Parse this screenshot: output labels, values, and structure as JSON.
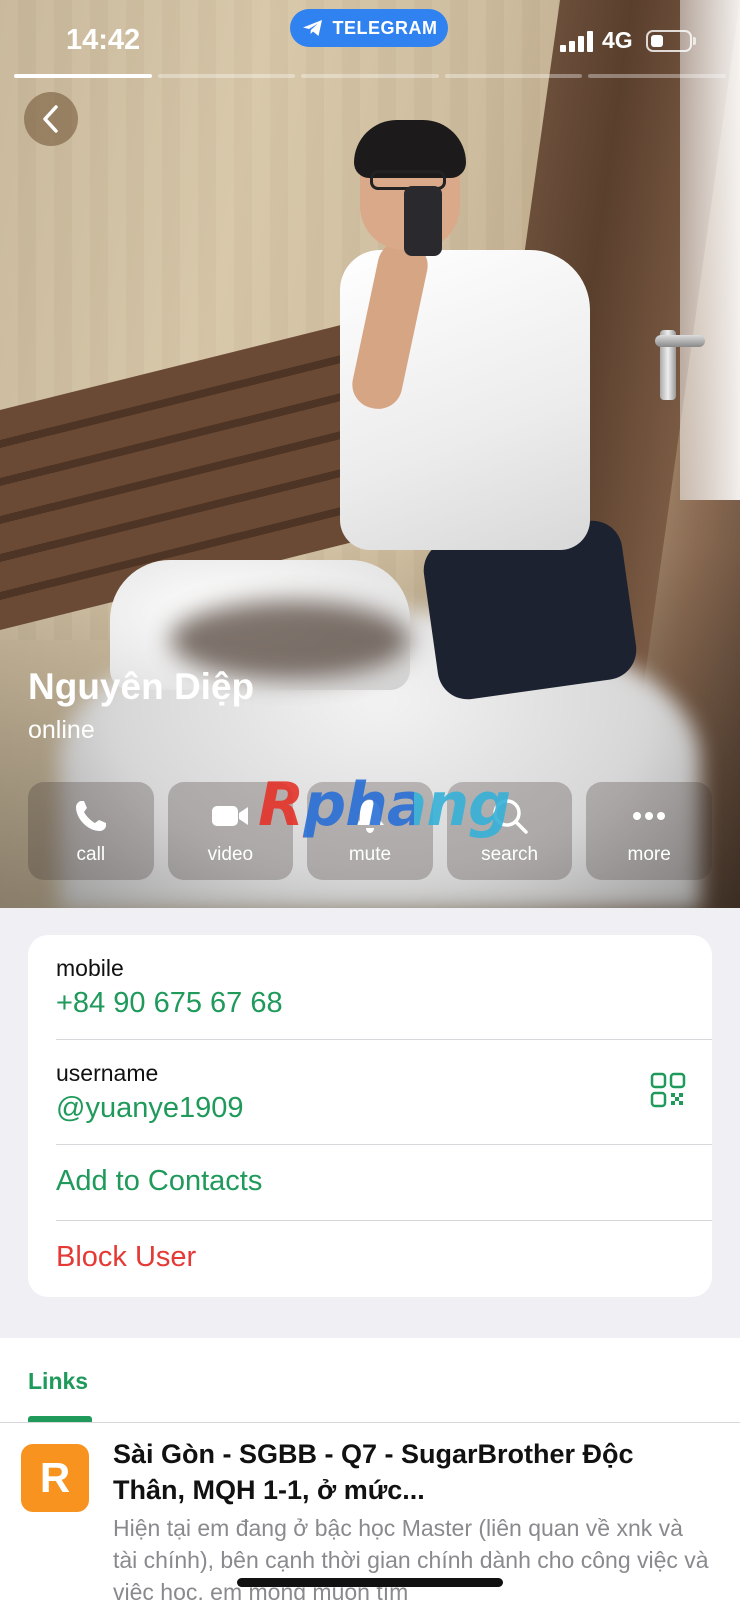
{
  "status_bar": {
    "time": "14:42",
    "app_pill": "TELEGRAM",
    "network": "4G"
  },
  "profile": {
    "name": "Nguyên Diệp",
    "status": "online"
  },
  "actions": [
    {
      "label": "call",
      "icon": "phone-icon"
    },
    {
      "label": "video",
      "icon": "video-camera-icon"
    },
    {
      "label": "mute",
      "icon": "bell-icon"
    },
    {
      "label": "search",
      "icon": "search-icon"
    },
    {
      "label": "more",
      "icon": "more-dots-icon"
    }
  ],
  "watermark": "Rphang",
  "info": {
    "mobile_label": "mobile",
    "mobile_value": "+84 90 675 67 68",
    "username_label": "username",
    "username_value": "@yuanye1909",
    "add_contact": "Add to Contacts",
    "block_user": "Block User"
  },
  "links": {
    "title": "Links",
    "item": {
      "icon_letter": "R",
      "title": "Sài Gòn - SGBB - Q7 - SugarBrother Độc Thân, MQH 1-1, ở mức...",
      "description": "Hiện tại em đang ở bậc học Master (liên quan về xnk và tài chính), bên cạnh thời gian chính dành cho công việc và việc học, em mong muốn tìm"
    }
  },
  "colors": {
    "accent_green": "#1f9a5b",
    "danger_red": "#e53935",
    "telegram_blue": "#2f82f0",
    "link_icon_orange": "#f7931e"
  }
}
